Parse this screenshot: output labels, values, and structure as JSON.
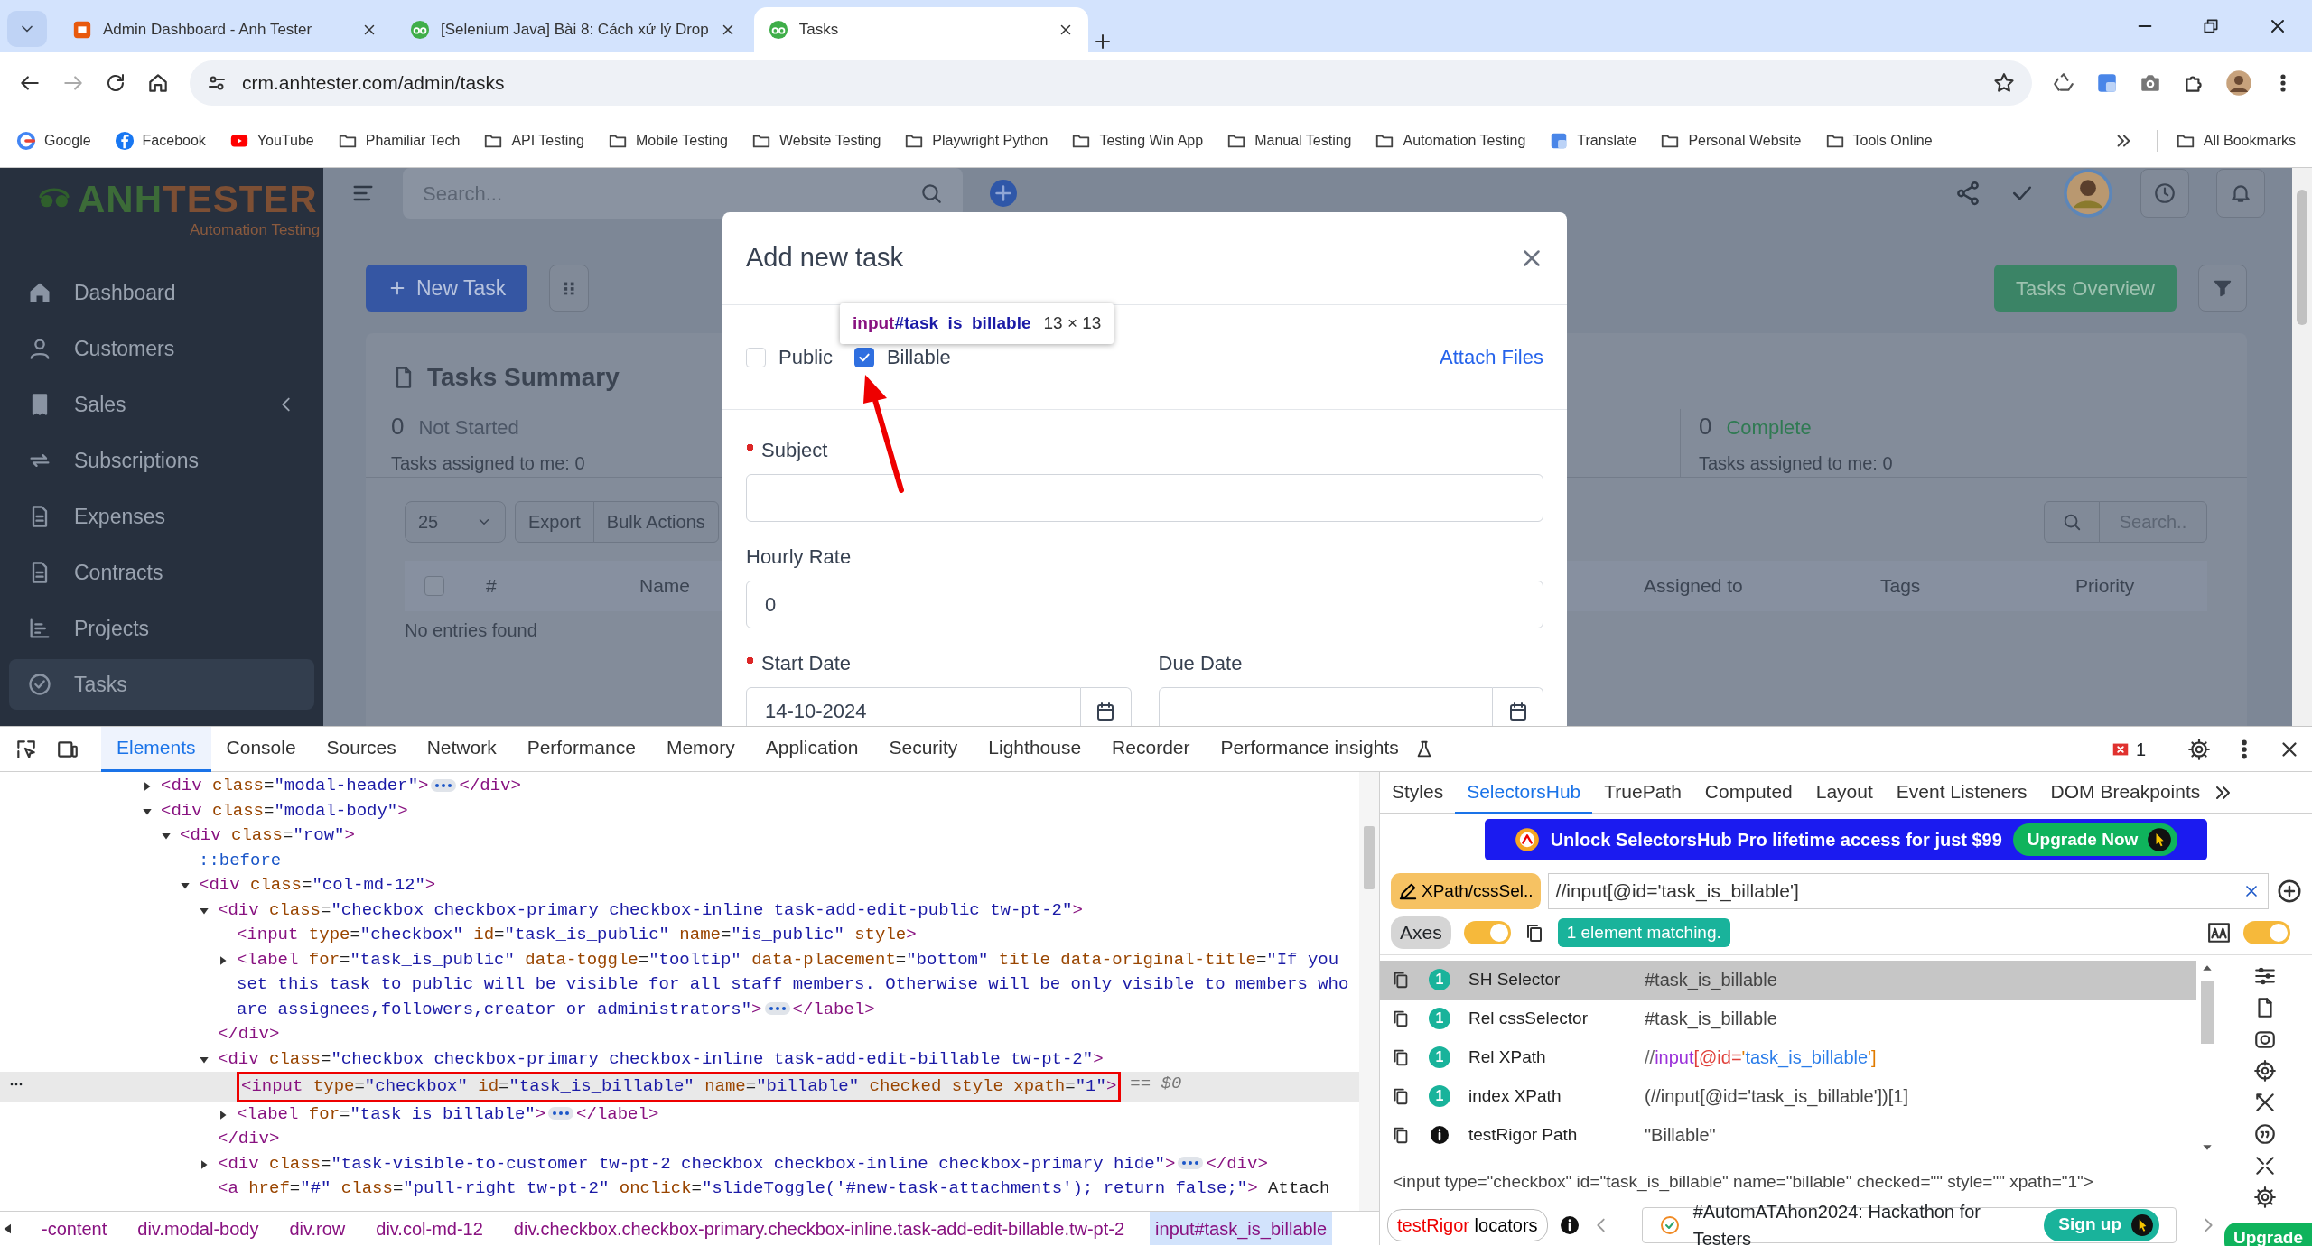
{
  "browser": {
    "tabs": [
      {
        "title": "Admin Dashboard - Anh Tester",
        "kind": "square",
        "selected": false
      },
      {
        "title": "[Selenium Java] Bài 8: Cách xử lý Drop",
        "kind": "glasses",
        "selected": false
      },
      {
        "title": "Tasks",
        "kind": "glasses",
        "selected": true
      }
    ],
    "forward_enabled": false,
    "url": "crm.anhtester.com/admin/tasks",
    "bookmarks": [
      {
        "label": "Google",
        "kind": "google"
      },
      {
        "label": "Facebook",
        "kind": "facebook"
      },
      {
        "label": "YouTube",
        "kind": "youtube"
      },
      {
        "label": "Phamiliar Tech",
        "kind": "folder"
      },
      {
        "label": "API Testing",
        "kind": "folder"
      },
      {
        "label": "Mobile Testing",
        "kind": "folder"
      },
      {
        "label": "Website Testing",
        "kind": "folder"
      },
      {
        "label": "Playwright Python",
        "kind": "folder"
      },
      {
        "label": "Testing Win App",
        "kind": "folder"
      },
      {
        "label": "Manual Testing",
        "kind": "folder"
      },
      {
        "label": "Automation Testing",
        "kind": "folder"
      },
      {
        "label": "Translate",
        "kind": "translate"
      },
      {
        "label": "Personal Website",
        "kind": "folder"
      },
      {
        "label": "Tools Online",
        "kind": "folder"
      }
    ],
    "all_bookmarks": "All Bookmarks"
  },
  "app": {
    "logo": {
      "first": "ANH",
      "second": "TESTER",
      "tagline": "Automation Testing"
    },
    "sidebar": [
      {
        "label": "Dashboard",
        "selected": false
      },
      {
        "label": "Customers",
        "selected": false
      },
      {
        "label": "Sales",
        "selected": false,
        "submenu": true
      },
      {
        "label": "Subscriptions",
        "selected": false
      },
      {
        "label": "Expenses",
        "selected": false
      },
      {
        "label": "Contracts",
        "selected": false
      },
      {
        "label": "Projects",
        "selected": false
      },
      {
        "label": "Tasks",
        "selected": true
      }
    ],
    "search_placeholder": "Search...",
    "new_task": "New Task",
    "tasks_overview": "Tasks Overview",
    "summary": {
      "title": "Tasks Summary",
      "stats": [
        {
          "count": "0",
          "label": "Not Started",
          "sub": "Tasks assigned to me: 0",
          "color": "#4b5565"
        },
        {
          "count": "0",
          "label": "Complete",
          "sub": "Tasks assigned to me: 0",
          "color": "#2f7a52"
        }
      ]
    },
    "page_size": "25",
    "toolbar_buttons": [
      "Export",
      "Bulk Actions"
    ],
    "table_search_placeholder": "Search..",
    "select_all_checked": false,
    "columns": [
      "#",
      "Name",
      "Assigned to",
      "Tags",
      "Priority"
    ],
    "empty": "No entries found"
  },
  "modal": {
    "title": "Add new task",
    "checkboxes": [
      {
        "label": "Public",
        "checked": false
      },
      {
        "label": "Billable",
        "checked": true
      }
    ],
    "attach": "Attach Files",
    "tooltip": {
      "selector": "input",
      "id": "#task_is_billable",
      "size": "13 × 13"
    },
    "fields": [
      {
        "label": "Subject",
        "required": true
      },
      {
        "label": "Hourly Rate",
        "required": false,
        "value": "0"
      }
    ],
    "dates": [
      {
        "label": "Start Date",
        "required": true,
        "value": "14-10-2024"
      },
      {
        "label": "Due Date",
        "required": false
      }
    ]
  },
  "devtools": {
    "tabs": [
      {
        "label": "Elements",
        "selected": true
      },
      {
        "label": "Console",
        "selected": false
      },
      {
        "label": "Sources",
        "selected": false
      },
      {
        "label": "Network",
        "selected": false
      },
      {
        "label": "Performance",
        "selected": false
      },
      {
        "label": "Memory",
        "selected": false
      },
      {
        "label": "Application",
        "selected": false
      },
      {
        "label": "Security",
        "selected": false
      },
      {
        "label": "Lighthouse",
        "selected": false
      },
      {
        "label": "Recorder",
        "selected": false
      },
      {
        "label": "Performance insights",
        "selected": false
      }
    ],
    "errors": "1",
    "tree": [
      {
        "markup": "<div class=\"modal-header\">",
        "closing": "</div>",
        "expanded": false,
        "selected": false
      },
      {
        "markup": "<div class=\"modal-body\">",
        "expanded": true,
        "selected": false,
        "children": [
          {
            "markup": "<div class=\"row\">",
            "expanded": true,
            "selected": false,
            "children": [
              {
                "markup": "::before",
                "kind": "pseudo",
                "selected": false
              },
              {
                "markup": "<div class=\"col-md-12\">",
                "expanded": true,
                "selected": false,
                "children": [
                  {
                    "markup": "<div class=\"checkbox checkbox-primary checkbox-inline task-add-edit-public tw-pt-2\">",
                    "expanded": true,
                    "selected": false,
                    "closing": "</div>",
                    "children": [
                      {
                        "markup": "<input type=\"checkbox\" id=\"task_is_public\" name=\"is_public\" style>",
                        "selected": false
                      },
                      {
                        "markup": "<label for=\"task_is_public\" data-toggle=\"tooltip\" data-placement=\"bottom\" title data-original-title=\"If you set this task to public will be visible for all staff members. Otherwise will be only visible to members who are assignees,followers,creator or administrators\">",
                        "closing": "</label>",
                        "expanded": false,
                        "selected": false
                      }
                    ]
                  },
                  {
                    "markup": "<div class=\"checkbox checkbox-primary checkbox-inline task-add-edit-billable tw-pt-2\">",
                    "expanded": true,
                    "selected": false,
                    "closing": "</div>",
                    "children": [
                      {
                        "markup": "<input type=\"checkbox\" id=\"task_is_billable\" name=\"billable\" checked style xpath=\"1\">",
                        "selected": true,
                        "annotated": true,
                        "marker": "== $0"
                      },
                      {
                        "markup": "<label for=\"task_is_billable\">",
                        "closing": "</label>",
                        "expanded": false,
                        "selected": false
                      }
                    ]
                  },
                  {
                    "markup": "<div class=\"task-visible-to-customer tw-pt-2 checkbox checkbox-inline checkbox-primary hide\">",
                    "closing": "</div>",
                    "expanded": false,
                    "selected": false
                  },
                  {
                    "markup": "<a href=\"#\" class=\"pull-right tw-pt-2\" onclick=\"slideToggle('#new-task-attachments'); return false;\"> Attach",
                    "selected": false
                  }
                ]
              }
            ]
          }
        ]
      }
    ],
    "breadcrumbs": [
      {
        "label": "-content",
        "selected": false
      },
      {
        "label": "div.modal-body",
        "selected": false
      },
      {
        "label": "div.row",
        "selected": false
      },
      {
        "label": "div.col-md-12",
        "selected": false
      },
      {
        "label": "div.checkbox.checkbox-primary.checkbox-inline.task-add-edit-billable.tw-pt-2",
        "selected": false
      },
      {
        "label": "input#task_is_billable",
        "selected": true
      }
    ],
    "side_tabs": [
      {
        "label": "Styles",
        "selected": false
      },
      {
        "label": "SelectorsHub",
        "selected": true
      },
      {
        "label": "TruePath",
        "selected": false
      },
      {
        "label": "Computed",
        "selected": false
      },
      {
        "label": "Layout",
        "selected": false
      },
      {
        "label": "Event Listeners",
        "selected": false
      },
      {
        "label": "DOM Breakpoints",
        "selected": false
      }
    ],
    "selectorshub": {
      "banner": "Unlock SelectorsHub Pro lifetime access for just $99",
      "upgrade_now": "Upgrade Now",
      "type_button": "XPath/cssSel..",
      "query": "//input[@id='task_is_billable']",
      "axes": "Axes",
      "axes_on": true,
      "match": "1 element matching.",
      "case_on": true,
      "results": [
        {
          "kind": "count",
          "count": "1",
          "label": "SH Selector",
          "value": "#task_is_billable",
          "syntax": false,
          "selected": true
        },
        {
          "kind": "count",
          "count": "1",
          "label": "Rel cssSelector",
          "value": "#task_is_billable",
          "syntax": false,
          "selected": false
        },
        {
          "kind": "count",
          "count": "1",
          "label": "Rel XPath",
          "value": "//input[@id='task_is_billable']",
          "syntax": true,
          "selected": false
        },
        {
          "kind": "count",
          "count": "1",
          "label": "index XPath",
          "value": "(//input[@id='task_is_billable'])[1]",
          "syntax": false,
          "selected": false
        },
        {
          "kind": "info",
          "label": "testRigor Path",
          "value": "\"Billable\"",
          "syntax": false,
          "selected": false
        }
      ],
      "outer_html": "<input type=\"checkbox\" id=\"task_is_billable\" name=\"billable\" checked=\"\" style=\"\" xpath=\"1\">",
      "footer": {
        "brand": "testRigor",
        "brand_rest": "locators",
        "promo": "#AutomATAhon2024: Hackathon for Testers",
        "sign_up": "Sign up",
        "upgrade": "Upgrade"
      }
    }
  }
}
